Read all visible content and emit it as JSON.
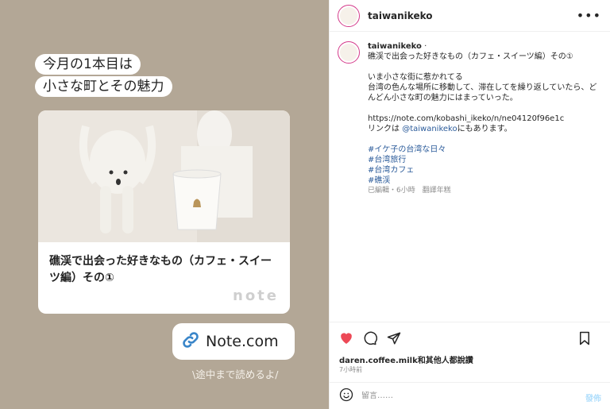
{
  "post_image": {
    "headline_line1": "今月の1本目は",
    "headline_line2": "小さな町とその魅力",
    "card_title": "礁渓で出会った好きなもの（カフェ・スイーツ編）その①",
    "card_brand": "note",
    "link_label": "Note.com",
    "read_more": "\\途中まで読めるよ/"
  },
  "header": {
    "username": "taiwanikeko",
    "more_label": "•••"
  },
  "caption": {
    "author": "taiwanikeko",
    "separator": "·",
    "title": "礁渓で出会った好きなもの（カフェ・スイーツ編）その①",
    "line1": "いま小さな街に惹かれてる",
    "line2": "台湾の色んな場所に移動して、滞在してを繰り返していたら、どんどん小さな町の魅力にはまっていった。",
    "url": "https://note.com/kobashi_ikeko/n/ne04120f96e1c",
    "link_prefix": "リンクは ",
    "link_mention": "@taiwanikeko",
    "link_suffix": "にもあります。",
    "hashtags": [
      "#イケ子の台湾な日々",
      "#台湾旅行",
      "#台湾カフェ",
      "#礁渓"
    ],
    "meta": "已編輯・6小時　翻譯年糕"
  },
  "engagement": {
    "likes_text": "daren.coffee.milk和其他人都說讚",
    "time": "7小時前"
  },
  "comment": {
    "placeholder": "留言……",
    "post_label": "發佈"
  },
  "colors": {
    "heart": "#ed4956",
    "link": "#2b5b9a",
    "media_bg": "#b3a796",
    "link_icon": "#3a86c9"
  }
}
